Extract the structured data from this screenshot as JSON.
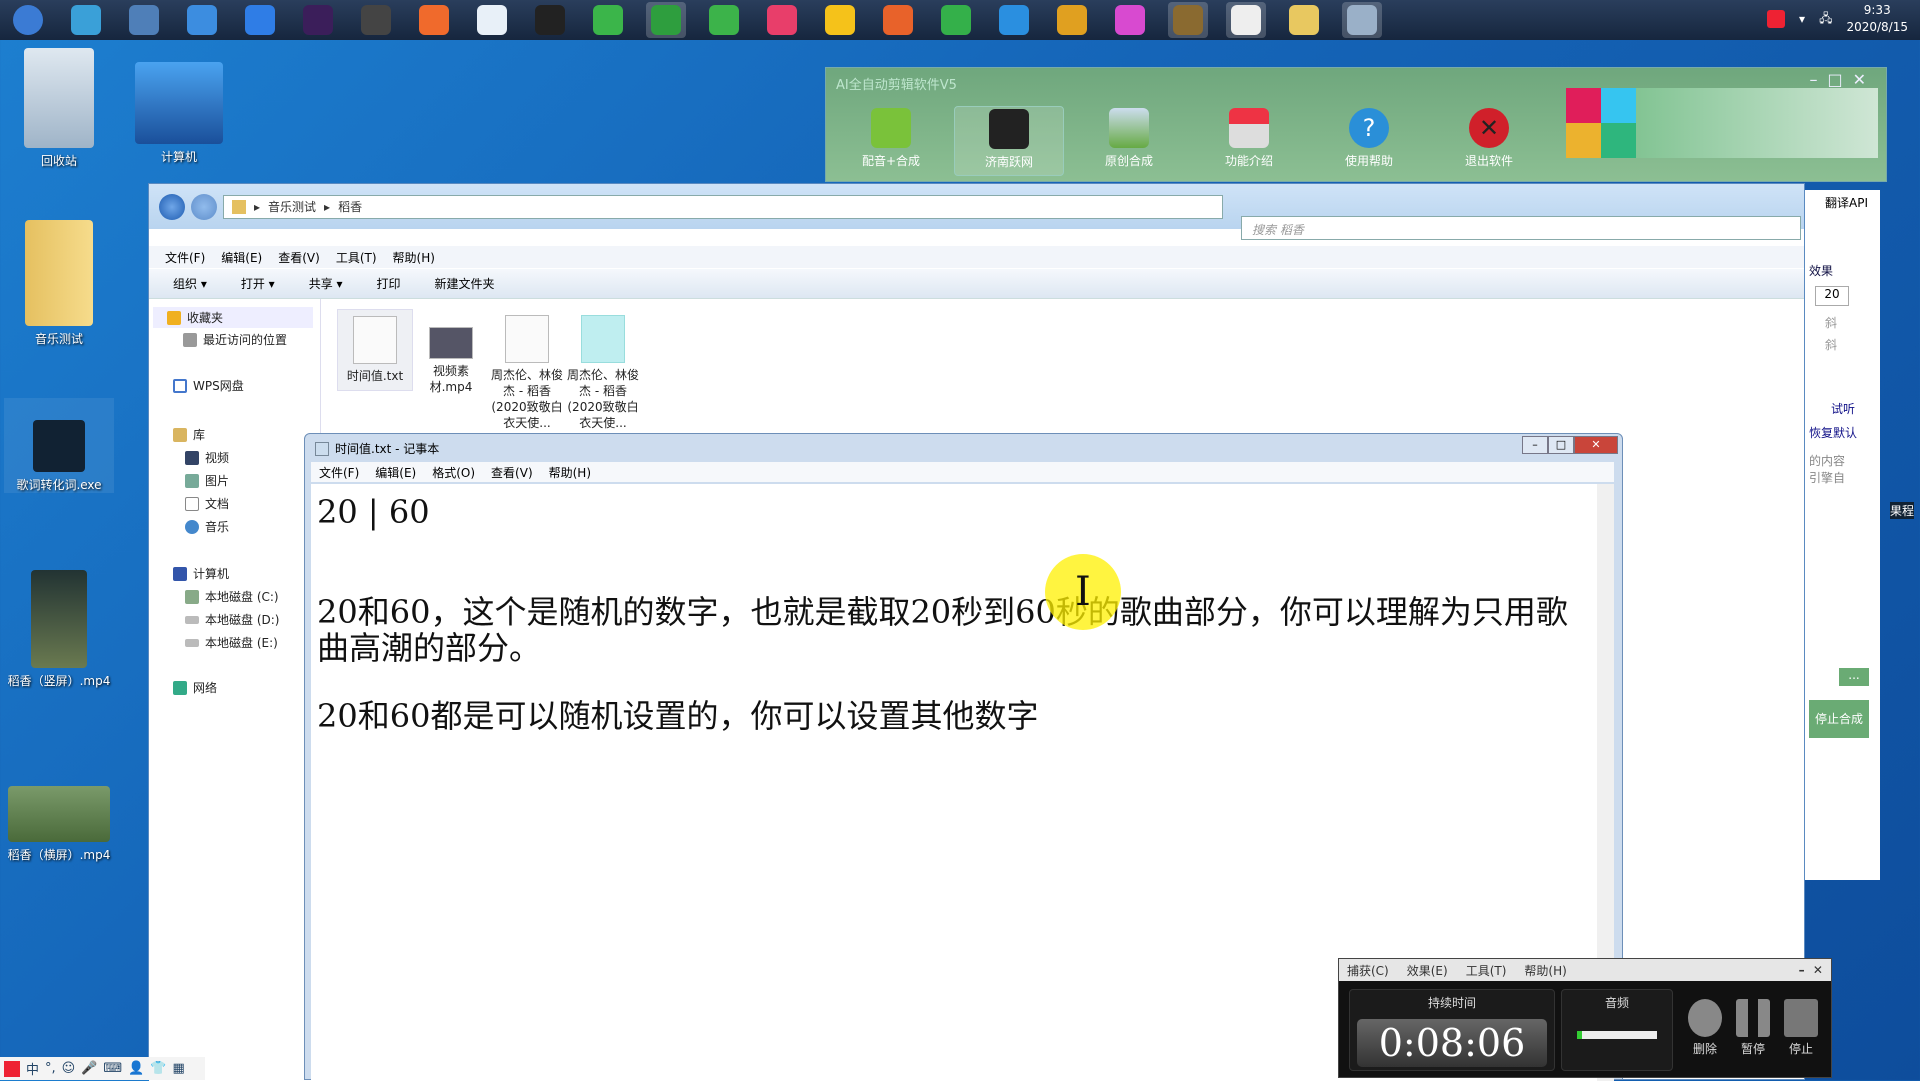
{
  "taskbar": {
    "apps": [
      {
        "icon": "start-orb-icon",
        "color": "#3b7bd4"
      },
      {
        "icon": "bird-app-icon",
        "color": "#3aa0d8"
      },
      {
        "icon": "m-app-icon",
        "color": "#4f7fb8"
      },
      {
        "icon": "qq-browser-icon",
        "color": "#3c8de0"
      },
      {
        "icon": "k-app-icon",
        "color": "#2f7de6"
      },
      {
        "icon": "after-effects-icon",
        "color": "#3b1e5a"
      },
      {
        "icon": "scissors-icon",
        "color": "#444"
      },
      {
        "icon": "settings-app-icon",
        "color": "#f06a2c"
      },
      {
        "icon": "pen-app-icon",
        "color": "#e8f0f8"
      },
      {
        "icon": "qq-icon",
        "color": "#222"
      },
      {
        "icon": "camtasia-icon",
        "color": "#3bb54a"
      },
      {
        "icon": "camtasia-recorder-icon",
        "color": "#2e9e3e"
      },
      {
        "icon": "wechat-icon",
        "color": "#3cb34a"
      },
      {
        "icon": "music-app-icon",
        "color": "#e83e6a"
      },
      {
        "icon": "m-yellow-app-icon",
        "color": "#f5c21a"
      },
      {
        "icon": "firefox-icon",
        "color": "#e8622a"
      },
      {
        "icon": "green-browser-icon",
        "color": "#34b04a"
      },
      {
        "icon": "ie-icon",
        "color": "#2a8fe0"
      },
      {
        "icon": "chrome-icon",
        "color": "#e0a020"
      },
      {
        "icon": "color-wheel-icon",
        "color": "#d84ad0"
      },
      {
        "icon": "video-editor-icon",
        "color": "#8a6a30"
      },
      {
        "icon": "camtasia-white-icon",
        "color": "#eee"
      },
      {
        "icon": "file-explorer-icon",
        "color": "#e8c860"
      },
      {
        "icon": "notepad-icon",
        "color": "#9ab0c8"
      }
    ],
    "tray": {
      "time": "9:33",
      "date": "2020/8/15"
    }
  },
  "desktop": {
    "icons": [
      "回收站",
      "计算机",
      "音乐测试",
      "歌词转化词.exe",
      "稻香（竖屏）.mp4",
      "稻香（横屏）.mp4"
    ]
  },
  "ai_app": {
    "title": "AI全自动剪辑软件V5",
    "buttons": [
      "配音+合成",
      "济南跃网",
      "原创合成",
      "功能介绍",
      "使用帮助",
      "退出软件"
    ]
  },
  "explorer": {
    "breadcrumb": [
      "音乐测试",
      "稻香"
    ],
    "search_placeholder": "搜索 稻香",
    "menu": [
      "文件(F)",
      "编辑(E)",
      "查看(V)",
      "工具(T)",
      "帮助(H)"
    ],
    "toolbar": [
      "组织 ▾",
      "打开 ▾",
      "共享 ▾",
      "打印",
      "新建文件夹"
    ],
    "nav": {
      "favorites": "收藏夹",
      "recent": "最近访问的位置",
      "wps": "WPS网盘",
      "library": "库",
      "video": "视频",
      "pictures": "图片",
      "documents": "文档",
      "music": "音乐",
      "computer": "计算机",
      "c": "本地磁盘 (C:)",
      "d": "本地磁盘 (D:)",
      "e": "本地磁盘 (E:)",
      "network": "网络"
    },
    "files": [
      "时间值.txt",
      "视频素材.mp4",
      "周杰伦、林俊杰 - 稻香 (2020致敬白衣天使...",
      "周杰伦、林俊杰 - 稻香 (2020致敬白衣天使..."
    ]
  },
  "right_panel": {
    "tab": "翻译API",
    "effect": "效果",
    "value": "20",
    "check1": "斜",
    "check2": "斜",
    "listen": "试听",
    "restore": "恢复默认",
    "hint": "的内容 引擎自",
    "dots": "...",
    "stop": "停止合成",
    "side_text": "果程"
  },
  "notepad": {
    "title": "时间值.txt - 记事本",
    "menu": [
      "文件(F)",
      "编辑(E)",
      "格式(O)",
      "查看(V)",
      "帮助(H)"
    ],
    "line1": "20 | 60",
    "para1": "20和60，这个是随机的数字，也就是截取20秒到60秒的歌曲部分，你可以理解为只用歌曲高潮的部分。",
    "para2": "20和60都是可以随机设置的，你可以设置其他数字"
  },
  "recorder": {
    "menu": [
      "捕获(C)",
      "效果(E)",
      "工具(T)",
      "帮助(H)"
    ],
    "duration_label": "持续时间",
    "duration": "0:08:06",
    "audio_label": "音频",
    "audio_level": 0.06,
    "buttons": [
      "删除",
      "暂停",
      "停止"
    ]
  },
  "ime": {
    "label": "中"
  }
}
